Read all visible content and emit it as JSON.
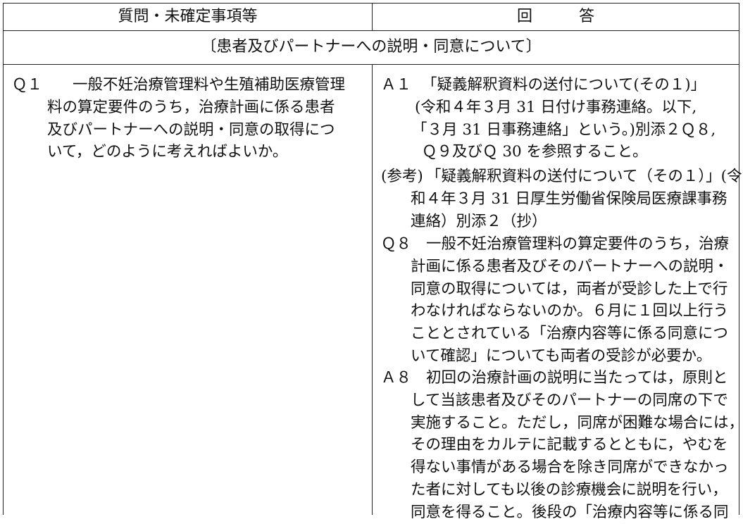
{
  "header": {
    "question_col": "質問・未確定事項等",
    "answer_col": "回　　　答"
  },
  "section_title": "〔患者及びパートナーへの説明・同意について〕",
  "q1": {
    "label": "Ｑ１",
    "lines": [
      "一般不妊治療管理料や生殖補助医療管理",
      "料の算定要件のうち，治療計画に係る患者",
      "及びパートナーへの説明・同意の取得につ",
      "いて，どのように考えればよいか。"
    ]
  },
  "a1": {
    "label": "Ａ１",
    "lines": [
      "「疑義解釈資料の送付について(その１)」",
      "(令和４年３月 31 日付け事務連絡。以下,",
      "「３月 31 日事務連絡」という。)別添２Ｑ８,",
      "Ｑ９及びＱ 30 を参照すること。"
    ]
  },
  "ref": {
    "label": "(参考)",
    "lines": [
      "「疑義解釈資料の送付について（その１）」(令",
      "和４年３月 31 日厚生労働省保険局医療課事務",
      "連絡）別添２（抄）"
    ]
  },
  "q8": {
    "label": "Ｑ８",
    "lines": [
      "一般不妊治療管理料の算定要件のうち，治療",
      "計画に係る患者及びそのパートナーへの説明・",
      "同意の取得については，両者が受診した上で行",
      "わなければならないのか。６月に１回以上行う",
      "こととされている「治療内容等に係る同意につ",
      "いて確認」についても両者の受診が必要か。"
    ]
  },
  "a8": {
    "label": "Ａ８",
    "lines": [
      "初回の治療計画の説明に当たっては，原則と",
      "して当該患者及びそのパートナーの同席の下で",
      "実施すること。ただし，同席が困難な場合には，",
      "その理由をカルテに記載するとともに，やむを",
      "得ない事情がある場合を除き同席ができなかっ",
      "た者に対しても以後の診療機会に説明を行い，",
      "同意を得ること。後段の「治療内容等に係る同"
    ]
  }
}
